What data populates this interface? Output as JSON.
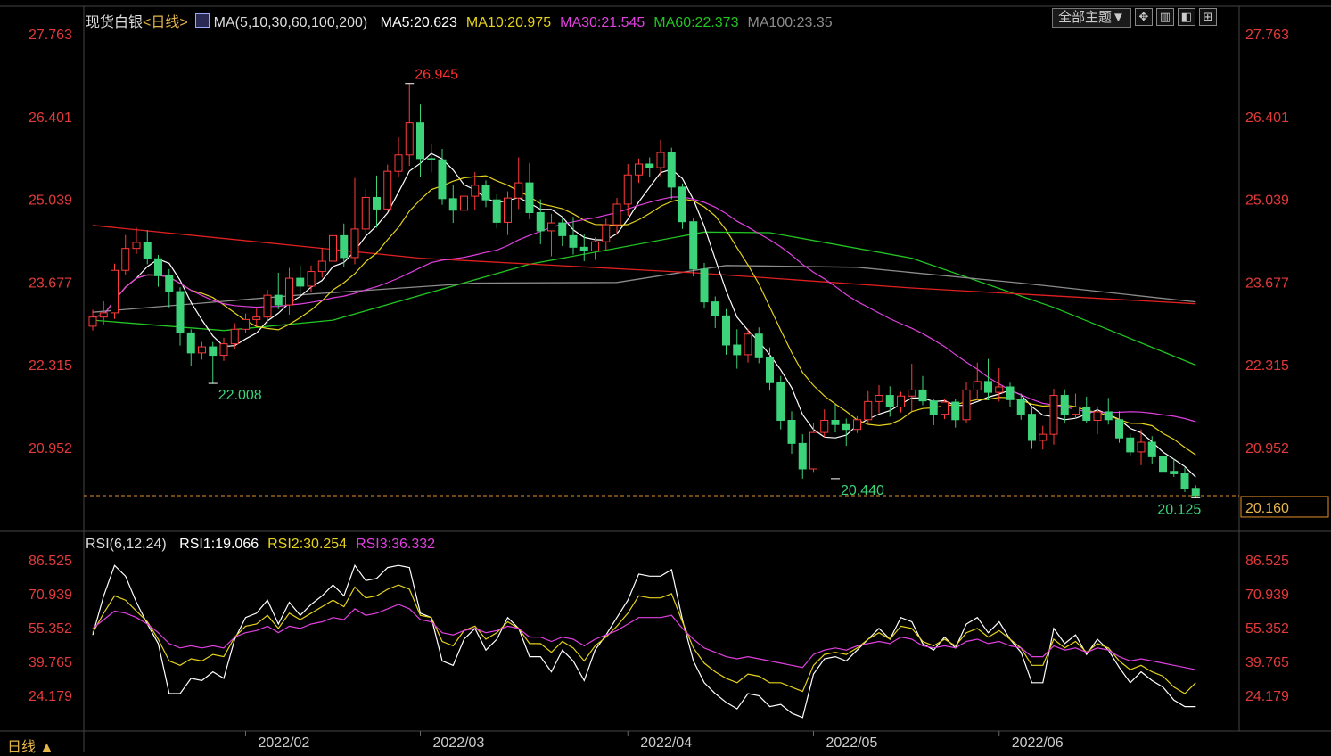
{
  "header": {
    "symbol": "现货白银",
    "period": "<日线>",
    "ma_label": "MA(5,10,30,60,100,200)",
    "ma_values": [
      {
        "text": "MA5:20.623",
        "color": "#ffffff"
      },
      {
        "text": "MA10:20.975",
        "color": "#e6d21c"
      },
      {
        "text": "MA30:21.545",
        "color": "#e040e0"
      },
      {
        "text": "MA60:22.373",
        "color": "#22c422"
      },
      {
        "text": "MA100:23.35",
        "color": "#8c8c8c"
      }
    ],
    "theme_button": "全部主题▼",
    "tool_icons": [
      "grid-plus-icon",
      "layout-icon",
      "panel-icon",
      "expand-icon"
    ]
  },
  "rsi_header": {
    "label": "RSI(6,12,24)",
    "values": [
      {
        "text": "RSI1:19.066",
        "color": "#ffffff"
      },
      {
        "text": "RSI2:30.254",
        "color": "#e6d21c"
      },
      {
        "text": "RSI3:36.332",
        "color": "#e040e0"
      }
    ]
  },
  "footer": {
    "period_tab": "日线 ▲"
  },
  "chart_data": [
    {
      "type": "candlestick",
      "title": "现货白银",
      "x_ticks": [
        "2022/02",
        "2022/03",
        "2022/04",
        "2022/05",
        "2022/06"
      ],
      "x_tick_index": [
        14,
        30,
        49,
        66,
        83
      ],
      "y_ticks": [
        27.763,
        26.401,
        25.039,
        23.677,
        22.315,
        20.952
      ],
      "ylim": [
        20.0,
        27.763
      ],
      "annotations": [
        {
          "text": "26.945",
          "index": 29,
          "value": 26.945,
          "kind": "high",
          "color": "#ff3030"
        },
        {
          "text": "22.008",
          "index": 11,
          "value": 22.008,
          "kind": "low",
          "color": "#3cd37a"
        },
        {
          "text": "20.440",
          "index": 68,
          "value": 20.44,
          "kind": "low",
          "color": "#3cd37a"
        },
        {
          "text": "20.125",
          "index": 101,
          "value": 20.125,
          "kind": "low",
          "color": "#3cd37a"
        }
      ],
      "last_price": 20.16,
      "colors": {
        "up": "#ff3b3b",
        "down": "#3cd37a",
        "axis_text": "#e23a3a"
      },
      "candles": [
        [
          22.95,
          23.22,
          22.88,
          23.1
        ],
        [
          23.1,
          23.36,
          22.98,
          23.17
        ],
        [
          23.17,
          23.98,
          23.07,
          23.87
        ],
        [
          23.87,
          24.45,
          23.8,
          24.23
        ],
        [
          24.23,
          24.57,
          24.14,
          24.33
        ],
        [
          24.33,
          24.53,
          23.97,
          24.06
        ],
        [
          24.06,
          24.12,
          23.6,
          23.78
        ],
        [
          23.78,
          23.89,
          23.26,
          23.52
        ],
        [
          23.52,
          23.59,
          22.63,
          22.84
        ],
        [
          22.84,
          22.9,
          22.3,
          22.51
        ],
        [
          22.51,
          22.69,
          22.4,
          22.61
        ],
        [
          22.61,
          22.69,
          22.0,
          22.47
        ],
        [
          22.47,
          22.76,
          22.38,
          22.66
        ],
        [
          22.66,
          23.0,
          22.57,
          22.9
        ],
        [
          22.9,
          23.16,
          22.84,
          23.06
        ],
        [
          23.06,
          23.24,
          22.95,
          23.1
        ],
        [
          23.1,
          23.55,
          23.0,
          23.46
        ],
        [
          23.46,
          23.83,
          23.23,
          23.3
        ],
        [
          23.3,
          23.91,
          23.14,
          23.74
        ],
        [
          23.74,
          23.95,
          23.48,
          23.61
        ],
        [
          23.61,
          23.95,
          23.52,
          23.85
        ],
        [
          23.85,
          24.24,
          23.75,
          24.02
        ],
        [
          24.02,
          24.57,
          23.93,
          24.44
        ],
        [
          24.44,
          24.64,
          23.93,
          24.08
        ],
        [
          24.08,
          25.39,
          23.97,
          24.55
        ],
        [
          24.55,
          25.21,
          24.48,
          25.07
        ],
        [
          25.07,
          25.43,
          24.57,
          24.88
        ],
        [
          24.88,
          25.61,
          24.85,
          25.5
        ],
        [
          25.5,
          26.06,
          25.41,
          25.77
        ],
        [
          25.77,
          26.94,
          25.59,
          26.3
        ],
        [
          26.3,
          26.6,
          25.4,
          25.71
        ],
        [
          25.71,
          25.95,
          25.48,
          25.69
        ],
        [
          25.69,
          25.87,
          24.95,
          25.05
        ],
        [
          25.05,
          25.28,
          24.65,
          24.86
        ],
        [
          24.86,
          25.21,
          24.46,
          25.09
        ],
        [
          25.09,
          25.49,
          24.86,
          25.27
        ],
        [
          25.27,
          25.35,
          24.91,
          25.03
        ],
        [
          25.03,
          25.12,
          24.56,
          24.66
        ],
        [
          24.66,
          25.17,
          24.45,
          25.06
        ],
        [
          25.06,
          25.73,
          24.88,
          25.31
        ],
        [
          25.31,
          25.63,
          24.71,
          24.82
        ],
        [
          24.82,
          25.04,
          24.3,
          24.52
        ],
        [
          24.52,
          24.8,
          24.1,
          24.65
        ],
        [
          24.65,
          24.72,
          24.27,
          24.44
        ],
        [
          24.44,
          24.75,
          24.13,
          24.25
        ],
        [
          24.25,
          24.46,
          24.02,
          24.19
        ],
        [
          24.19,
          24.41,
          24.04,
          24.34
        ],
        [
          24.34,
          24.72,
          24.21,
          24.62
        ],
        [
          24.62,
          25.06,
          24.47,
          24.96
        ],
        [
          24.96,
          25.62,
          24.77,
          25.44
        ],
        [
          25.44,
          25.71,
          25.31,
          25.62
        ],
        [
          25.62,
          25.73,
          25.4,
          25.56
        ],
        [
          25.56,
          26.02,
          25.4,
          25.81
        ],
        [
          25.81,
          25.89,
          25.04,
          25.24
        ],
        [
          25.24,
          25.3,
          24.55,
          24.67
        ],
        [
          24.67,
          24.73,
          23.77,
          23.89
        ],
        [
          23.89,
          23.99,
          23.24,
          23.35
        ],
        [
          23.35,
          23.44,
          22.92,
          23.12
        ],
        [
          23.12,
          23.23,
          22.48,
          22.64
        ],
        [
          22.64,
          22.9,
          22.25,
          22.48
        ],
        [
          22.48,
          22.91,
          22.35,
          22.82
        ],
        [
          22.82,
          22.93,
          22.34,
          22.43
        ],
        [
          22.43,
          22.6,
          21.89,
          22.02
        ],
        [
          22.02,
          22.13,
          21.25,
          21.4
        ],
        [
          21.4,
          21.55,
          20.85,
          21.02
        ],
        [
          21.02,
          21.17,
          20.44,
          20.6
        ],
        [
          20.6,
          21.35,
          20.55,
          21.2
        ],
        [
          21.2,
          21.58,
          21.12,
          21.4
        ],
        [
          21.4,
          21.66,
          21.2,
          21.33
        ],
        [
          21.33,
          21.43,
          20.98,
          21.25
        ],
        [
          21.25,
          21.47,
          21.19,
          21.41
        ],
        [
          21.41,
          21.88,
          21.35,
          21.71
        ],
        [
          21.71,
          21.98,
          21.52,
          21.81
        ],
        [
          21.81,
          21.96,
          21.46,
          21.62
        ],
        [
          21.62,
          21.87,
          21.53,
          21.8
        ],
        [
          21.8,
          22.33,
          21.55,
          21.9
        ],
        [
          21.9,
          22.13,
          21.65,
          21.72
        ],
        [
          21.72,
          21.75,
          21.32,
          21.5
        ],
        [
          21.5,
          21.75,
          21.42,
          21.7
        ],
        [
          21.7,
          21.75,
          21.28,
          21.41
        ],
        [
          21.41,
          22.03,
          21.36,
          21.9
        ],
        [
          21.9,
          22.35,
          21.73,
          22.04
        ],
        [
          22.04,
          22.41,
          21.73,
          21.86
        ],
        [
          21.86,
          22.26,
          21.71,
          21.95
        ],
        [
          21.95,
          22.02,
          21.62,
          21.74
        ],
        [
          21.74,
          21.84,
          21.41,
          21.5
        ],
        [
          21.5,
          21.61,
          20.93,
          21.07
        ],
        [
          21.07,
          21.31,
          20.92,
          21.17
        ],
        [
          21.17,
          21.92,
          21.0,
          21.81
        ],
        [
          21.81,
          21.91,
          21.36,
          21.5
        ],
        [
          21.5,
          21.84,
          21.43,
          21.62
        ],
        [
          21.62,
          21.79,
          21.36,
          21.4
        ],
        [
          21.4,
          21.62,
          21.17,
          21.54
        ],
        [
          21.54,
          21.77,
          21.33,
          21.41
        ],
        [
          21.41,
          21.55,
          21.03,
          21.11
        ],
        [
          21.11,
          21.18,
          20.82,
          20.88
        ],
        [
          20.88,
          21.25,
          20.66,
          21.04
        ],
        [
          21.04,
          21.14,
          20.68,
          20.8
        ],
        [
          20.8,
          20.84,
          20.53,
          20.56
        ],
        [
          20.56,
          20.77,
          20.47,
          20.52
        ],
        [
          20.52,
          20.62,
          20.22,
          20.28
        ],
        [
          20.28,
          20.33,
          20.12,
          20.16
        ]
      ],
      "ma_lines": [
        {
          "name": "MA5",
          "color": "#ffffff",
          "period": 5
        },
        {
          "name": "MA10",
          "color": "#e6d21c",
          "period": 10
        },
        {
          "name": "MA30",
          "color": "#e040e0",
          "period": 30
        }
      ],
      "approx_lines": [
        {
          "name": "MA60",
          "color": "#22c422",
          "points": [
            [
              0,
              23.05
            ],
            [
              12,
              22.88
            ],
            [
              22,
              23.05
            ],
            [
              40,
              23.97
            ],
            [
              56,
              24.5
            ],
            [
              62,
              24.49
            ],
            [
              75,
              24.07
            ],
            [
              88,
              23.26
            ],
            [
              101,
              22.31
            ]
          ]
        },
        {
          "name": "MA100",
          "color": "#8c8c8c",
          "points": [
            [
              0,
              23.18
            ],
            [
              20,
              23.48
            ],
            [
              35,
              23.66
            ],
            [
              48,
              23.67
            ],
            [
              58,
              23.95
            ],
            [
              70,
              23.92
            ],
            [
              85,
              23.66
            ],
            [
              101,
              23.35
            ]
          ]
        },
        {
          "name": "MA200",
          "color": "#e02020",
          "points": [
            [
              0,
              24.61
            ],
            [
              30,
              24.07
            ],
            [
              55,
              23.83
            ],
            [
              75,
              23.58
            ],
            [
              101,
              23.32
            ]
          ]
        }
      ]
    },
    {
      "type": "line",
      "title": "RSI(6,12,24)",
      "y_ticks": [
        86.525,
        70.939,
        55.352,
        39.765,
        24.179
      ],
      "ylim": [
        10,
        92
      ],
      "series": [
        {
          "name": "RSI1",
          "color": "#ffffff",
          "values": [
            52,
            70,
            84,
            79,
            67,
            57,
            48,
            25,
            25,
            32,
            31,
            35,
            32,
            50,
            60,
            62,
            68,
            57,
            67,
            61,
            66,
            70,
            75,
            70,
            84,
            77,
            78,
            83,
            84,
            83,
            62,
            60,
            40,
            38,
            50,
            55,
            45,
            50,
            60,
            55,
            42,
            42,
            35,
            45,
            40,
            31,
            45,
            52,
            60,
            68,
            80,
            79,
            79,
            82,
            59,
            40,
            30,
            25,
            21,
            18,
            25,
            24,
            19,
            20,
            16,
            14,
            34,
            41,
            42,
            40,
            45,
            50,
            55,
            50,
            60,
            58,
            48,
            45,
            51,
            46,
            57,
            60,
            53,
            58,
            50,
            44,
            30,
            30,
            55,
            48,
            52,
            43,
            50,
            45,
            37,
            30,
            35,
            31,
            28,
            22,
            19,
            19
          ]
        },
        {
          "name": "RSI2",
          "color": "#e6d21c",
          "values": [
            53,
            62,
            70,
            68,
            63,
            58,
            50,
            40,
            38,
            41,
            40,
            43,
            42,
            51,
            56,
            57,
            61,
            55,
            62,
            59,
            62,
            65,
            68,
            65,
            74,
            69,
            70,
            73,
            75,
            73,
            61,
            60,
            49,
            47,
            54,
            56,
            50,
            53,
            58,
            55,
            48,
            48,
            44,
            49,
            46,
            40,
            47,
            51,
            56,
            62,
            70,
            69,
            69,
            71,
            58,
            46,
            39,
            35,
            32,
            30,
            34,
            33,
            30,
            30,
            28,
            26,
            38,
            43,
            44,
            43,
            46,
            50,
            53,
            50,
            56,
            55,
            49,
            47,
            50,
            47,
            53,
            55,
            51,
            54,
            50,
            46,
            38,
            38,
            50,
            46,
            49,
            44,
            48,
            46,
            40,
            36,
            38,
            35,
            33,
            28,
            25,
            30
          ]
        },
        {
          "name": "RSI3",
          "color": "#e040e0",
          "values": [
            55,
            59,
            63,
            62,
            60,
            57,
            53,
            48,
            46,
            47,
            46,
            47,
            46,
            51,
            53,
            54,
            56,
            53,
            56,
            55,
            57,
            58,
            60,
            59,
            64,
            61,
            62,
            64,
            66,
            64,
            59,
            58,
            53,
            52,
            54,
            55,
            53,
            54,
            56,
            55,
            51,
            51,
            49,
            51,
            50,
            47,
            50,
            52,
            54,
            57,
            60,
            60,
            60,
            61,
            55,
            50,
            46,
            44,
            42,
            41,
            42,
            41,
            40,
            39,
            38,
            37,
            43,
            45,
            46,
            45,
            47,
            48,
            49,
            48,
            51,
            50,
            47,
            46,
            47,
            46,
            49,
            50,
            48,
            49,
            47,
            46,
            42,
            42,
            47,
            45,
            46,
            44,
            46,
            45,
            42,
            40,
            41,
            40,
            39,
            38,
            37,
            36
          ]
        }
      ]
    }
  ]
}
